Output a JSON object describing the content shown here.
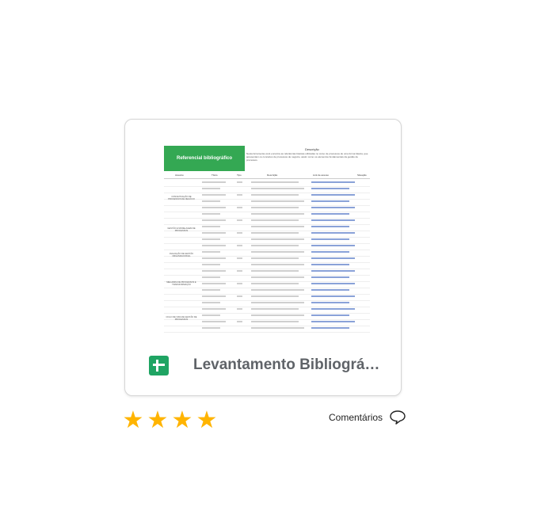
{
  "card": {
    "file_title": "Levantamento Bibliográfico",
    "file_icon": "google-sheets-icon",
    "accent_color": "#1fa463",
    "thumbnail": {
      "title_cell": "Referencial bibliográfico",
      "desc_head": "Descrição",
      "desc_text": "Nesta ferramenta você encontra as referências básicas utilizadas no curso de processos de uma forma básica, que apresentam os conceitos de processos de negócio, assim como os elementos fundamentais da gestão de processos.",
      "columns": [
        "Assunto",
        "Título",
        "Tipo",
        "Descrição",
        "Link de acesso",
        "Situação"
      ],
      "categories": [
        "CONCEITUAÇÃO DE PROCESSOS DE NEGÓCIO",
        "GESTÃO E MODELAGEM DE PROCESSOS",
        "AVALIAÇÃO DE GESTÃO ORGANIZACIONAL",
        "MELHORIA DE PROCESSOS E TRANSFORMAÇÃO",
        "CICLO DE VIDA DE GESTÃO DE PROCESSOS"
      ]
    }
  },
  "rating": {
    "stars_filled": 4,
    "star_color": "#ffb400"
  },
  "comments": {
    "label": "Comentários",
    "icon": "speech-bubble-icon"
  }
}
